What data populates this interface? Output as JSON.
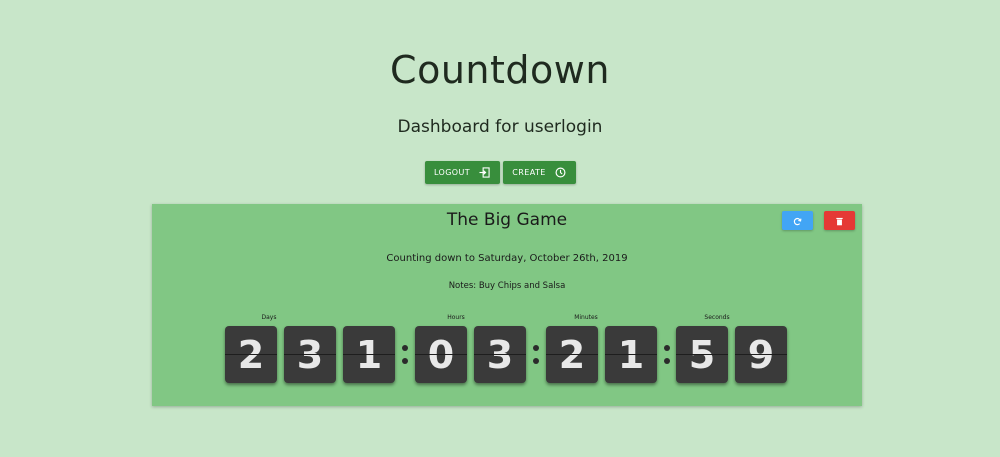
{
  "header": {
    "title": "Countdown",
    "subtitle": "Dashboard for userlogin"
  },
  "toolbar": {
    "logout_label": "LOGOUT",
    "logout_icon": "logout-icon",
    "create_label": "CREATE",
    "create_icon": "clock-icon"
  },
  "card": {
    "title": "The Big Game",
    "refresh_icon": "refresh-icon",
    "delete_icon": "trash-icon",
    "counting_text": "Counting down to Saturday, October 26th, 2019",
    "notes_text": "Notes: Buy Chips and Salsa",
    "units": {
      "days": "Days",
      "hours": "Hours",
      "minutes": "Minutes",
      "seconds": "Seconds"
    },
    "digits": {
      "days": [
        "2",
        "3",
        "1"
      ],
      "hours": [
        "0",
        "3"
      ],
      "minutes": [
        "2",
        "1"
      ],
      "seconds": [
        "5",
        "9"
      ]
    }
  },
  "colors": {
    "background": "#c8e6c9",
    "primary_button": "#388e3c",
    "card": "#81c784",
    "refresh_button": "#42a5f5",
    "delete_button": "#e53935",
    "digit_tile": "#3a3a3a"
  }
}
